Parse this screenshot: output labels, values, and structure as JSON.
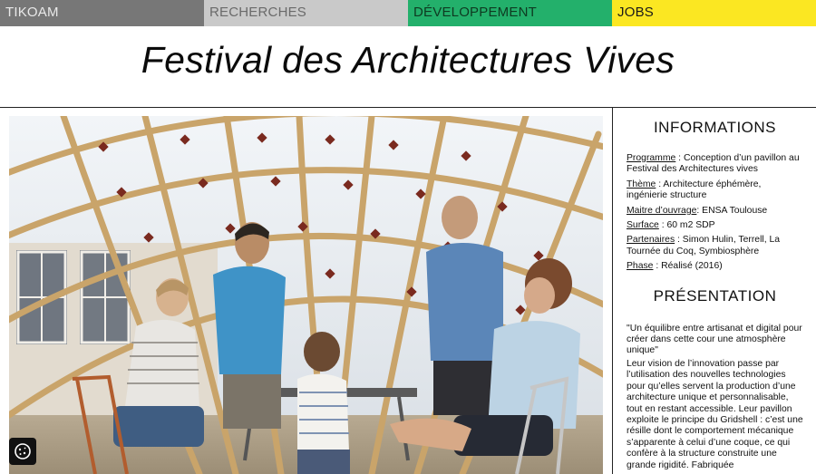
{
  "nav": {
    "items": [
      {
        "label": "TIKOAM",
        "color": "#777777"
      },
      {
        "label": "RECHERCHES",
        "color": "#c9c9c9"
      },
      {
        "label": "DÉVELOPPEMENT",
        "color": "#23b06b"
      },
      {
        "label": "JOBS",
        "color": "#fbe722"
      }
    ]
  },
  "page": {
    "title": "Festival des Architectures Vives"
  },
  "info": {
    "heading": "INFORMATIONS",
    "rows": [
      {
        "key": "Programme",
        "value": " : Conception d’un pavillon au Festival des Architectures vives"
      },
      {
        "key": "Thème",
        "value": " : Architecture éphémère, ingénierie structure"
      },
      {
        "key": "Maitre d’ouvrage",
        "value": ": ENSA Toulouse"
      },
      {
        "key": "Surface",
        "value": " : 60 m2 SDP"
      },
      {
        "key": "Partenaires",
        "value": " : Simon Hulin, Terrell, La Tournée du Coq, Symbiosphère"
      },
      {
        "key": "Phase",
        "value": " : Réalisé (2016)"
      }
    ]
  },
  "presentation": {
    "heading": "PRÉSENTATION",
    "quote": "\"Un équilibre entre artisanat et digital pour créer dans cette cour une atmosphère unique\"",
    "text": "Leur vision de l’innovation passe par l’utilisation des nouvelles technologies pour qu’elles servent la production d’une architecture unique et personnalisable, tout en restant accessible. Leur pavillon exploite le principe du Gridshell : c’est une résille dont le comportement mécanique s’apparente à celui d’une coque, ce qui confère à la structure construite une grande rigidité. Fabriquée"
  },
  "icons": {
    "cookie": "cookie-icon"
  },
  "colors": {
    "wood": "#c9a46a",
    "membrane": "#e6ecf1"
  }
}
